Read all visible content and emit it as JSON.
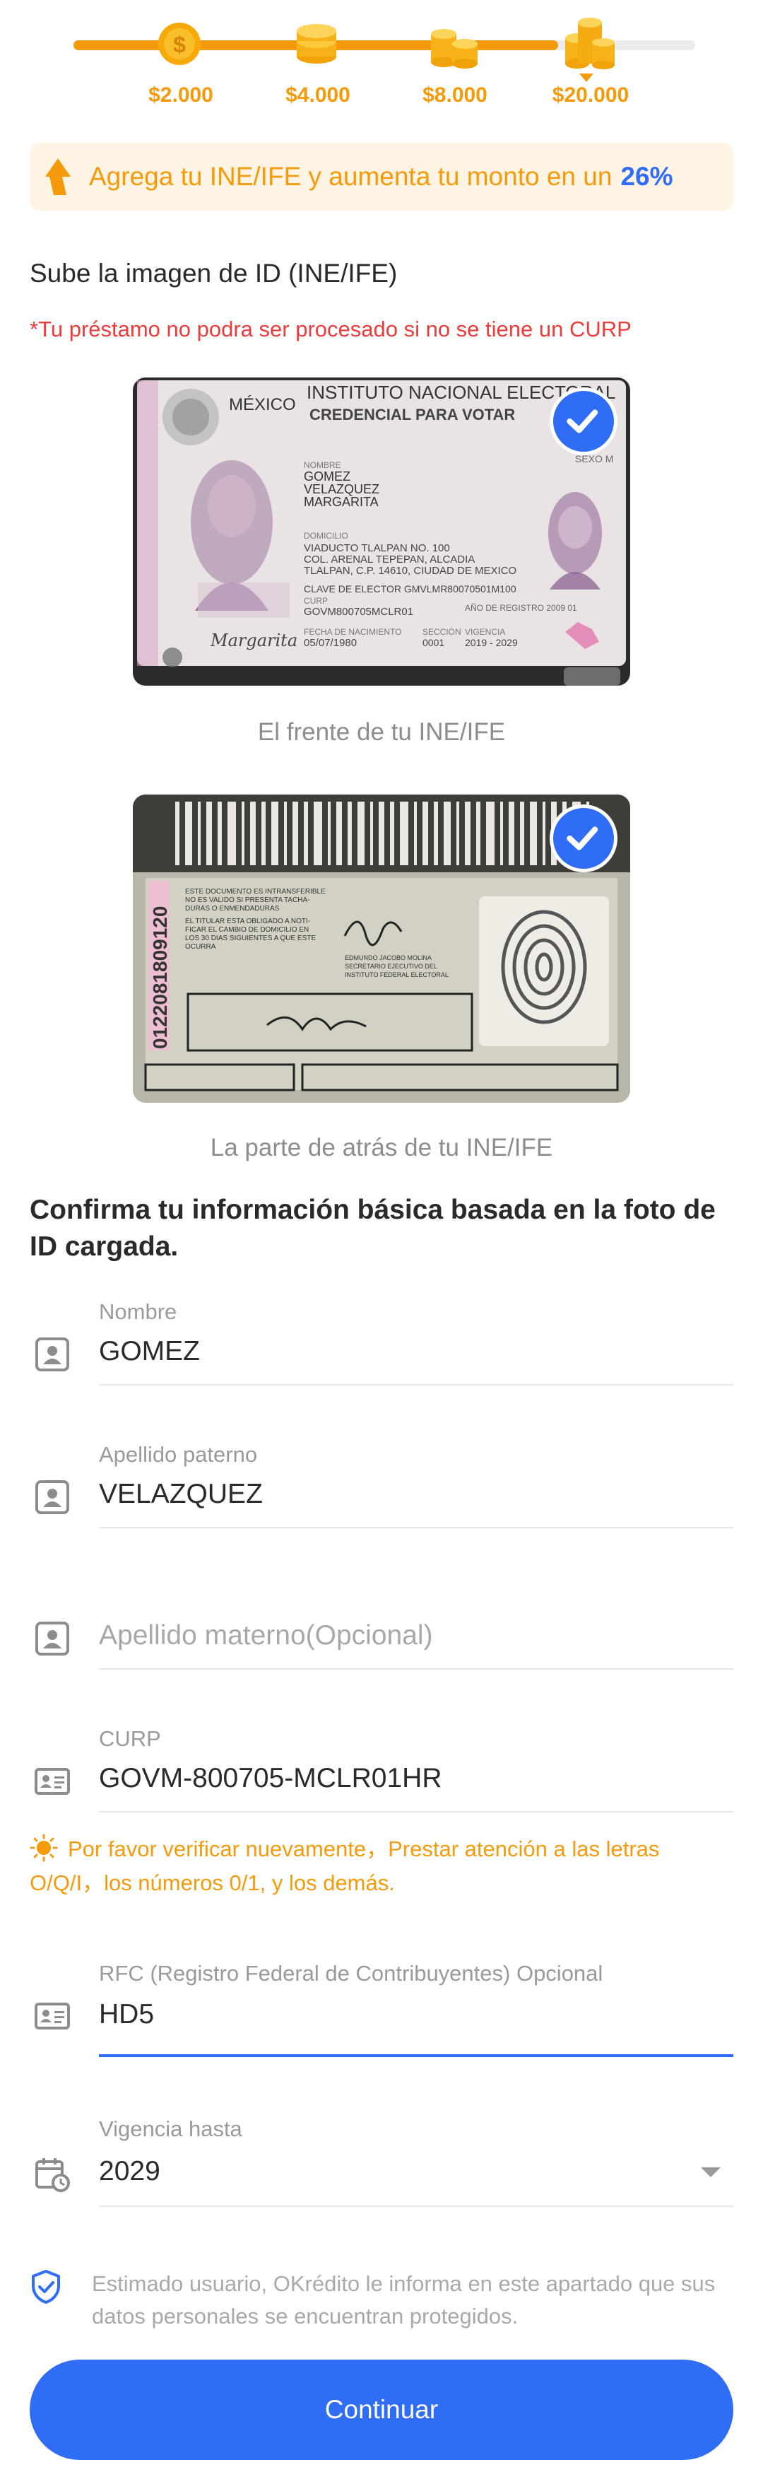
{
  "progress": {
    "amounts": [
      "$2.000",
      "$4.000",
      "$8.000",
      "$20.000"
    ],
    "current_index": 3,
    "fill_fraction": 0.78,
    "color": "#f59a0b"
  },
  "banner": {
    "text": "Agrega tu INE/IFE y aumenta tu monto en un",
    "percent": "26%",
    "icon": "arrow-up-icon"
  },
  "upload": {
    "title": "Sube la imagen de ID (INE/IFE)",
    "warning": "*Tu préstamo no podra ser procesado si no se tiene un CURP",
    "front": {
      "caption": "El frente de tu INE/IFE",
      "checked": true,
      "card": {
        "country": "MÉXICO",
        "institute": "INSTITUTO NACIONAL ELECTORAL",
        "credential": "CREDENCIAL PARA VOTAR",
        "sex": "SEXO M",
        "name_label": "NOMBRE",
        "name_lines": [
          "GOMEZ",
          "VELAZQUEZ",
          "MARGARITA"
        ],
        "address_label": "DOMICILIO",
        "address_lines": [
          "VIADUCTO TLALPAN NO. 100",
          "COL. ARENAL TEPEPAN, ALCADIA",
          "TLALPAN, C.P. 14610, CIUDAD DE MEXICO"
        ],
        "elector_key": "CLAVE DE ELECTOR   GMVLMR80070501M100",
        "curp_label": "CURP",
        "curp": "GOVM800705MCLR01",
        "registry": "AÑO DE REGISTRO 2009 01",
        "birth_label": "FECHA DE NACIMIENTO",
        "birth": "05/07/1980",
        "section_label": "SECCIÓN",
        "section": "0001",
        "validity_label": "VIGENCIA",
        "validity": "2019 - 2029",
        "signature": "Margarita"
      }
    },
    "back": {
      "caption": "La parte de atrás de tu INE/IFE",
      "checked": true,
      "card": {
        "vertical_number": "0122081809120",
        "legal_lines": [
          "ESTE DOCUMENTO ES INTRANSFERIBLE",
          "NO ES VALIDO SI PRESENTA TACHA-",
          "DURAS O ENMENDADURAS",
          "EL TITULAR ESTA OBLIGADO A NOTI-",
          "FICAR EL CAMBIO DE DOMICILIO EN",
          "LOS 30 DIAS SIGUIENTES A QUE ESTE",
          "OCURRA"
        ],
        "secretary_lines": [
          "EDMUNDO JACOBO MOLINA",
          "SECRETARIO EJECUTIVO DEL",
          "INSTITUTO FEDERAL ELECTORAL"
        ]
      }
    }
  },
  "confirm": {
    "title": "Confirma tu información básica basada en la foto de ID cargada."
  },
  "fields": {
    "nombre": {
      "label": "Nombre",
      "value": "GOMEZ",
      "icon": "person-card-icon"
    },
    "paterno": {
      "label": "Apellido paterno",
      "value": "VELAZQUEZ",
      "icon": "person-card-icon"
    },
    "materno": {
      "placeholder": "Apellido materno(Opcional)",
      "icon": "person-card-icon"
    },
    "curp": {
      "label": "CURP",
      "value": "GOVM-800705-MCLR01HR",
      "icon": "id-card-icon"
    },
    "rfc": {
      "label": "RFC (Registro Federal de Contribuyentes) Opcional",
      "value": "HD5",
      "icon": "id-card-icon"
    },
    "vigencia": {
      "label": "Vigencia hasta",
      "value": "2029",
      "icon": "calendar-clock-icon"
    }
  },
  "hint": {
    "text": "Por favor verificar nuevamente，Prestar atención a las letras O/Q/I，los números 0/1, y los demás.",
    "icon": "lightbulb-icon"
  },
  "notice": {
    "text": "Estimado usuario, OKrédito le informa en este apartado que sus datos personales se encuentran protegidos.",
    "icon": "shield-check-icon"
  },
  "button": {
    "label": "Continuar",
    "color": "#2f6df6"
  },
  "colors": {
    "accent": "#2f6df6",
    "orange": "#f59a0b",
    "warning": "#ee3b3b"
  }
}
